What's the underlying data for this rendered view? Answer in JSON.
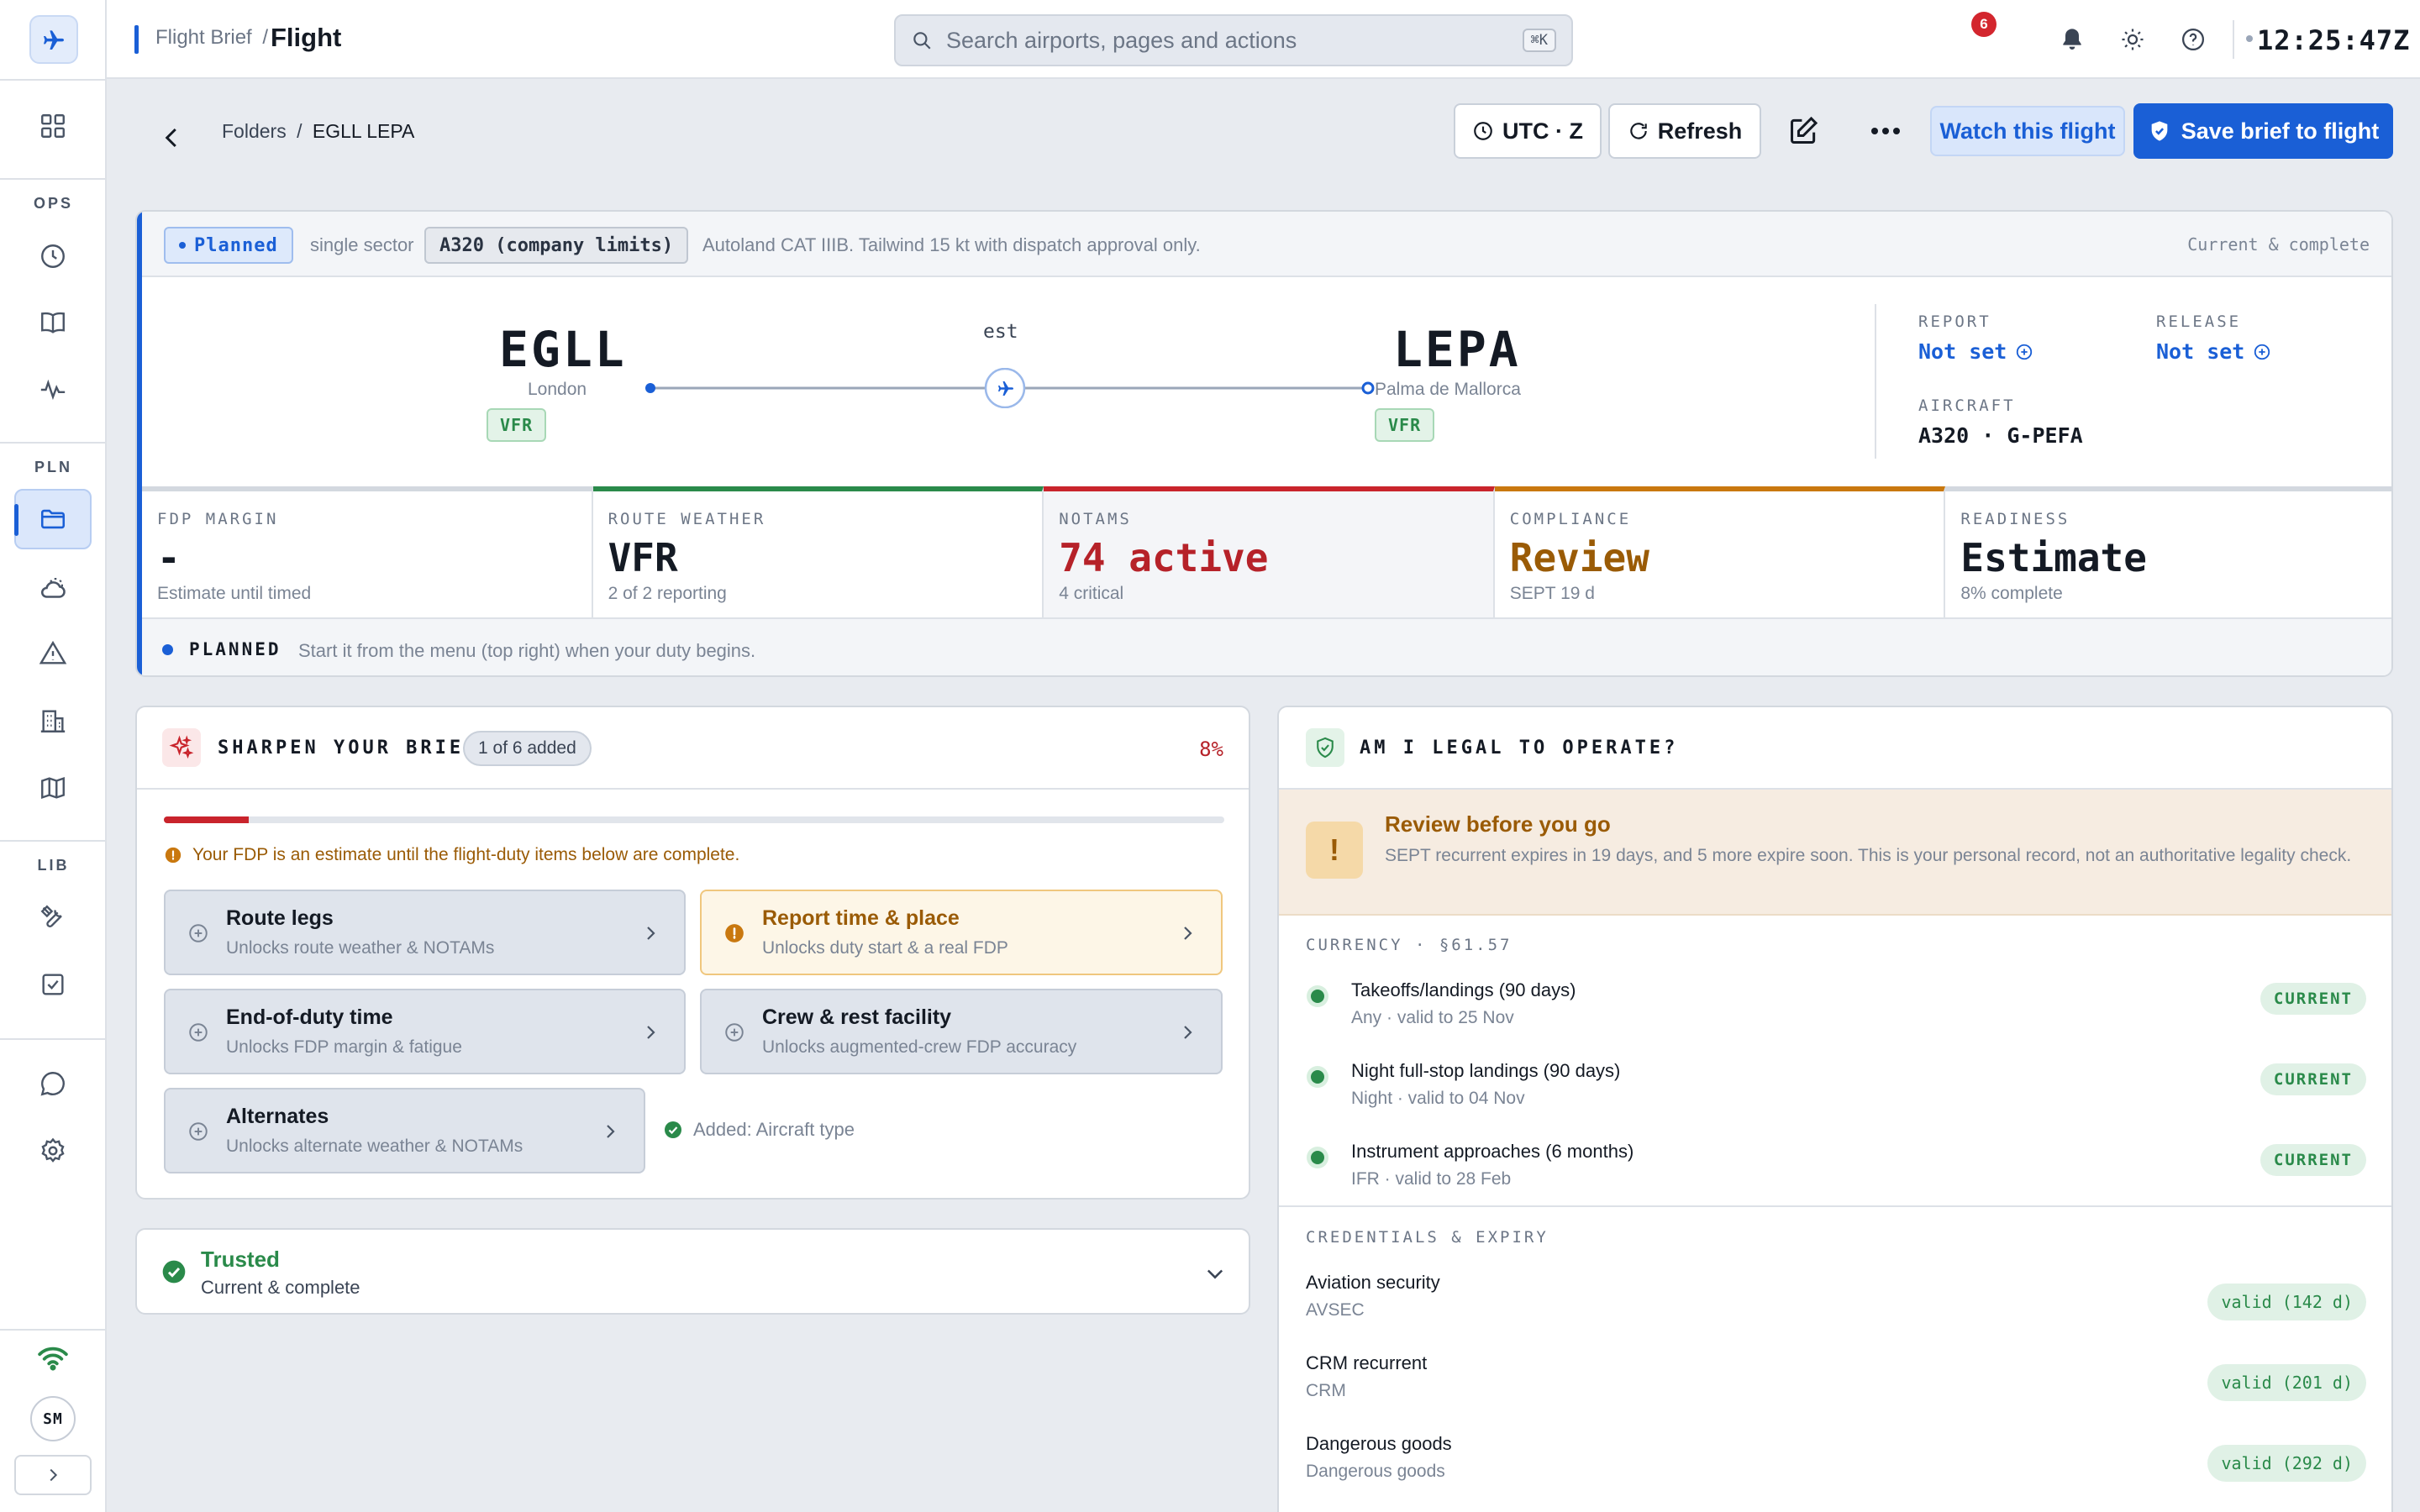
{
  "topbar": {
    "crumb": "Flight Brief",
    "crumb_sep": "/",
    "title": "Flight",
    "search_placeholder": "Search airports, pages and actions",
    "search_shortcut": "⌘K",
    "notification_count": "6",
    "clock": "12:25:47Z"
  },
  "sidebar": {
    "sections": {
      "ops": "OPS",
      "pln": "PLN",
      "lib": "LIB"
    },
    "items": [
      {
        "id": "dashboard",
        "icon": "grid-icon"
      },
      {
        "id": "history",
        "icon": "clock-icon"
      },
      {
        "id": "logbook",
        "icon": "book-icon"
      },
      {
        "id": "activity",
        "icon": "pulse-icon"
      },
      {
        "id": "folders",
        "icon": "folder-icon",
        "active": true
      },
      {
        "id": "weather",
        "icon": "weather-icon"
      },
      {
        "id": "notams",
        "icon": "warning-icon"
      },
      {
        "id": "airports",
        "icon": "building-icon"
      },
      {
        "id": "maps",
        "icon": "map-icon"
      },
      {
        "id": "tools",
        "icon": "tools-icon"
      },
      {
        "id": "checklists",
        "icon": "checklist-icon"
      },
      {
        "id": "chat",
        "icon": "chat-icon"
      },
      {
        "id": "settings",
        "icon": "gear-icon"
      }
    ],
    "avatar_initials": "SM"
  },
  "actions": {
    "breadcrumb_root": "Folders",
    "breadcrumb_sep": "/",
    "breadcrumb_current": "EGLL LEPA",
    "utc_label": "UTC · Z",
    "refresh_label": "Refresh",
    "watch_label": "Watch this flight",
    "save_label": "Save brief to flight"
  },
  "overview": {
    "status_pill": "Planned",
    "sector": "single sector",
    "aircraft_limits": "A320 (company limits)",
    "note": "Autoland CAT IIIB. Tailwind 15 kt with dispatch approval only.",
    "completeness": "Current & complete",
    "origin": {
      "code": "EGLL",
      "city": "London",
      "category": "VFR"
    },
    "destination": {
      "code": "LEPA",
      "city": "Palma de Mallorca",
      "category": "VFR"
    },
    "time_label": "est",
    "report": {
      "label": "REPORT",
      "value": "Not set"
    },
    "release": {
      "label": "RELEASE",
      "value": "Not set"
    },
    "aircraft": {
      "label": "AIRCRAFT",
      "value": "A320 · G-PEFA"
    },
    "kpis": [
      {
        "label": "FDP MARGIN",
        "value": "-",
        "sub": "Estimate until timed"
      },
      {
        "label": "ROUTE WEATHER",
        "value": "VFR",
        "sub": "2 of 2 reporting"
      },
      {
        "label": "NOTAMS",
        "value": "74 active",
        "sub": "4 critical"
      },
      {
        "label": "COMPLIANCE",
        "value": "Review",
        "sub": "SEPT 19 d"
      },
      {
        "label": "READINESS",
        "value": "Estimate",
        "sub": "8% complete"
      }
    ],
    "footer_state": "PLANNED",
    "footer_text": "Start it from the menu (top right) when your duty begins."
  },
  "sharpen": {
    "title": "SHARPEN YOUR BRIEF",
    "count_pill": "1 of 6 added",
    "percent_label": "8%",
    "progress": 0.08,
    "warning": "Your FDP is an estimate until the flight-duty items below are complete.",
    "tiles": [
      {
        "title": "Route legs",
        "sub": "Unlocks route weather & NOTAMs"
      },
      {
        "title": "Report time & place",
        "sub": "Unlocks duty start & a real FDP"
      },
      {
        "title": "End-of-duty time",
        "sub": "Unlocks FDP margin & fatigue"
      },
      {
        "title": "Crew & rest facility",
        "sub": "Unlocks augmented-crew FDP accuracy"
      },
      {
        "title": "Alternates",
        "sub": "Unlocks alternate weather & NOTAMs"
      }
    ],
    "added_note": "Added: Aircraft type"
  },
  "trusted": {
    "title": "Trusted",
    "sub": "Current & complete"
  },
  "legal": {
    "title": "AM I LEGAL TO OPERATE?",
    "review_title": "Review before you go",
    "review_text": "SEPT recurrent expires in 19 days, and 5 more expire soon. This is your personal record, not an authoritative legality check.",
    "currency_label": "CURRENCY · §61.57",
    "currency": [
      {
        "title": "Takeoffs/landings (90 days)",
        "sub": "Any · valid to 25 Nov",
        "status": "CURRENT"
      },
      {
        "title": "Night full-stop landings (90 days)",
        "sub": "Night · valid to 04 Nov",
        "status": "CURRENT"
      },
      {
        "title": "Instrument approaches (6 months)",
        "sub": "IFR · valid to 28 Feb",
        "status": "CURRENT"
      }
    ],
    "credentials_label": "CREDENTIALS & EXPIRY",
    "credentials": [
      {
        "title": "Aviation security",
        "sub": "AVSEC",
        "status": "valid (142 d)"
      },
      {
        "title": "CRM recurrent",
        "sub": "CRM",
        "status": "valid (201 d)"
      },
      {
        "title": "Dangerous goods",
        "sub": "Dangerous goods",
        "status": "valid (292 d)"
      }
    ]
  },
  "colors": {
    "accent": "#1a5fd6",
    "success": "#2a8a4a",
    "danger": "#c9242c",
    "warning": "#9a5b06"
  }
}
